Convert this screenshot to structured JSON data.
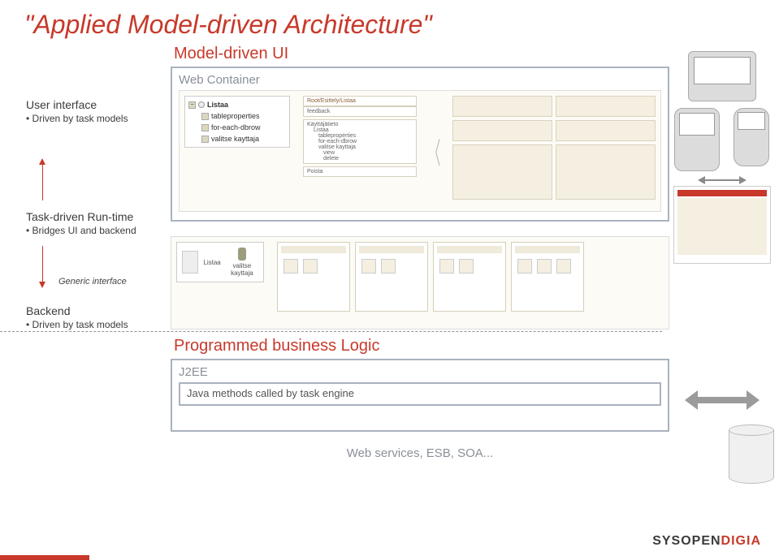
{
  "title": "\"Applied Model-driven Architecture\"",
  "left": {
    "ui": {
      "heading": "User interface",
      "sub": "Driven by task models"
    },
    "rt": {
      "heading": "Task-driven Run-time",
      "sub": "Bridges UI and backend"
    },
    "generic": "Generic interface",
    "backend": {
      "heading": "Backend",
      "sub": "Driven by task models"
    }
  },
  "center": {
    "mdui": "Model-driven UI",
    "web_container": "Web Container",
    "breadcrumb": "Root/Esittely/Listaa",
    "tree": {
      "root": "Listaa",
      "items": [
        "tableproperties",
        "for-each-dbrow",
        "valitse kayttaja"
      ]
    },
    "panel_labels": [
      "feedback",
      "Käyttäjätieto",
      "Listaa",
      "tableproperties",
      "for-each-dbrow",
      "valitse kayttaja",
      "view",
      "delete",
      "Poista"
    ],
    "rt_labels": {
      "left": "Listaa",
      "right": "valitse kayttaja"
    },
    "pbl": "Programmed business Logic",
    "j2ee": "J2EE",
    "j2ee_body": "Java methods called by task engine",
    "footer": "Web services, ESB, SOA..."
  },
  "logo": {
    "a": "SYSOPEN",
    "b": "DIGIA"
  }
}
